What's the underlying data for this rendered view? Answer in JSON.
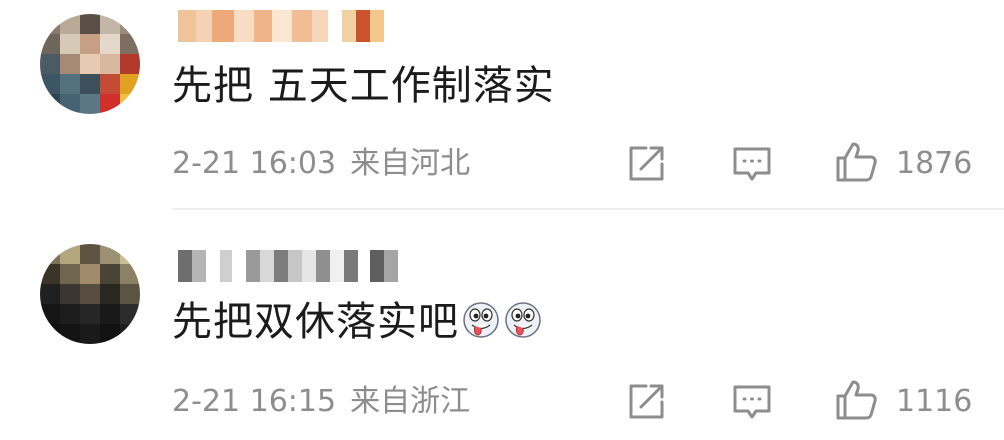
{
  "comments": [
    {
      "text": "先把 五天工作制落实",
      "time": "2-21 16:03",
      "location": "来自河北",
      "likes": "1876",
      "emoji_icons": []
    },
    {
      "text": "先把双休落实吧",
      "time": "2-21 16:15",
      "location": "来自浙江",
      "likes": "1116",
      "emoji_icons": [
        "ghost-tongue-emoji-icon",
        "ghost-tongue-emoji-icon"
      ]
    }
  ],
  "icons": {
    "share": "share-icon",
    "reply": "comment-icon",
    "like": "thumbs-up-icon"
  },
  "colors": {
    "text": "#1b1b1b",
    "meta": "#8d8d8d",
    "divider": "#eeeeee"
  }
}
